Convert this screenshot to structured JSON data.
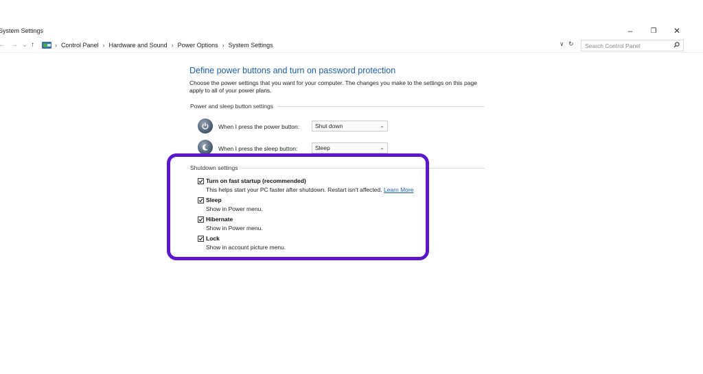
{
  "window": {
    "title": "System Settings",
    "controls": {
      "minimize": "–",
      "restore": "❐",
      "close": "✕"
    }
  },
  "address_bar": {
    "back": "←",
    "forward": "→",
    "recent": "⌄",
    "up": "↑",
    "breadcrumb": [
      "Control Panel",
      "Hardware and Sound",
      "Power Options",
      "System Settings"
    ],
    "separator": "›",
    "dropdown_glyph": "∨",
    "refresh_glyph": "↻",
    "search_placeholder": "Search Control Panel"
  },
  "content": {
    "title": "Define power buttons and turn on password protection",
    "description": "Choose the power settings that you want for your computer. The changes you make to the settings on this page apply to all of your power plans.",
    "power_section": {
      "label": "Power and sleep button settings",
      "rows": [
        {
          "label": "When I press the power button:",
          "value": "Shut down",
          "icon": "power-icon"
        },
        {
          "label": "When I press the sleep button:",
          "value": "Sleep",
          "icon": "sleep-icon"
        }
      ]
    },
    "shutdown_section": {
      "label": "Shutdown settings",
      "items": [
        {
          "label": "Turn on fast startup (recommended)",
          "checked": true,
          "description": "This helps start your PC faster after shutdown. Restart isn't affected.",
          "link": "Learn More"
        },
        {
          "label": "Sleep",
          "checked": true,
          "description": "Show in Power menu."
        },
        {
          "label": "Hibernate",
          "checked": true,
          "description": "Show in Power menu."
        },
        {
          "label": "Lock",
          "checked": true,
          "description": "Show in account picture menu."
        }
      ]
    }
  },
  "colors": {
    "accent": "#1e5fa8",
    "highlight_border": "#5b17c9"
  }
}
